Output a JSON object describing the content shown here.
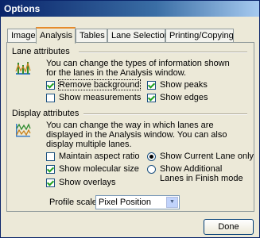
{
  "window": {
    "title": "Options"
  },
  "tabs": [
    {
      "label": "Image"
    },
    {
      "label": "Analysis"
    },
    {
      "label": "Tables"
    },
    {
      "label": "Lane Selection"
    },
    {
      "label": "Printing/Copying"
    }
  ],
  "lane_attributes": {
    "label": "Lane attributes",
    "description": "You can change the types of information shown for the lanes in the Analysis window.",
    "checkboxes": [
      {
        "label": "Remove background",
        "checked": true
      },
      {
        "label": "Show peaks",
        "checked": true
      },
      {
        "label": "Show measurements",
        "checked": false
      },
      {
        "label": "Show edges",
        "checked": true
      }
    ]
  },
  "display_attributes": {
    "label": "Display attributes",
    "description": "You can change the way in which lanes are displayed in the Analysis window. You can also display multiple lanes.",
    "checkboxes": [
      {
        "label": "Maintain aspect ratio",
        "checked": false
      },
      {
        "label": "Show molecular size",
        "checked": true
      },
      {
        "label": "Show overlays",
        "checked": true
      }
    ],
    "radios": [
      {
        "label": "Show Current Lane only",
        "selected": true
      },
      {
        "label": "Show Additional Lanes in Finish mode",
        "selected": false
      }
    ],
    "profile_scale": {
      "label": "Profile scale:",
      "value": "Pixel Position"
    }
  },
  "footer": {
    "done_label": "Done"
  }
}
